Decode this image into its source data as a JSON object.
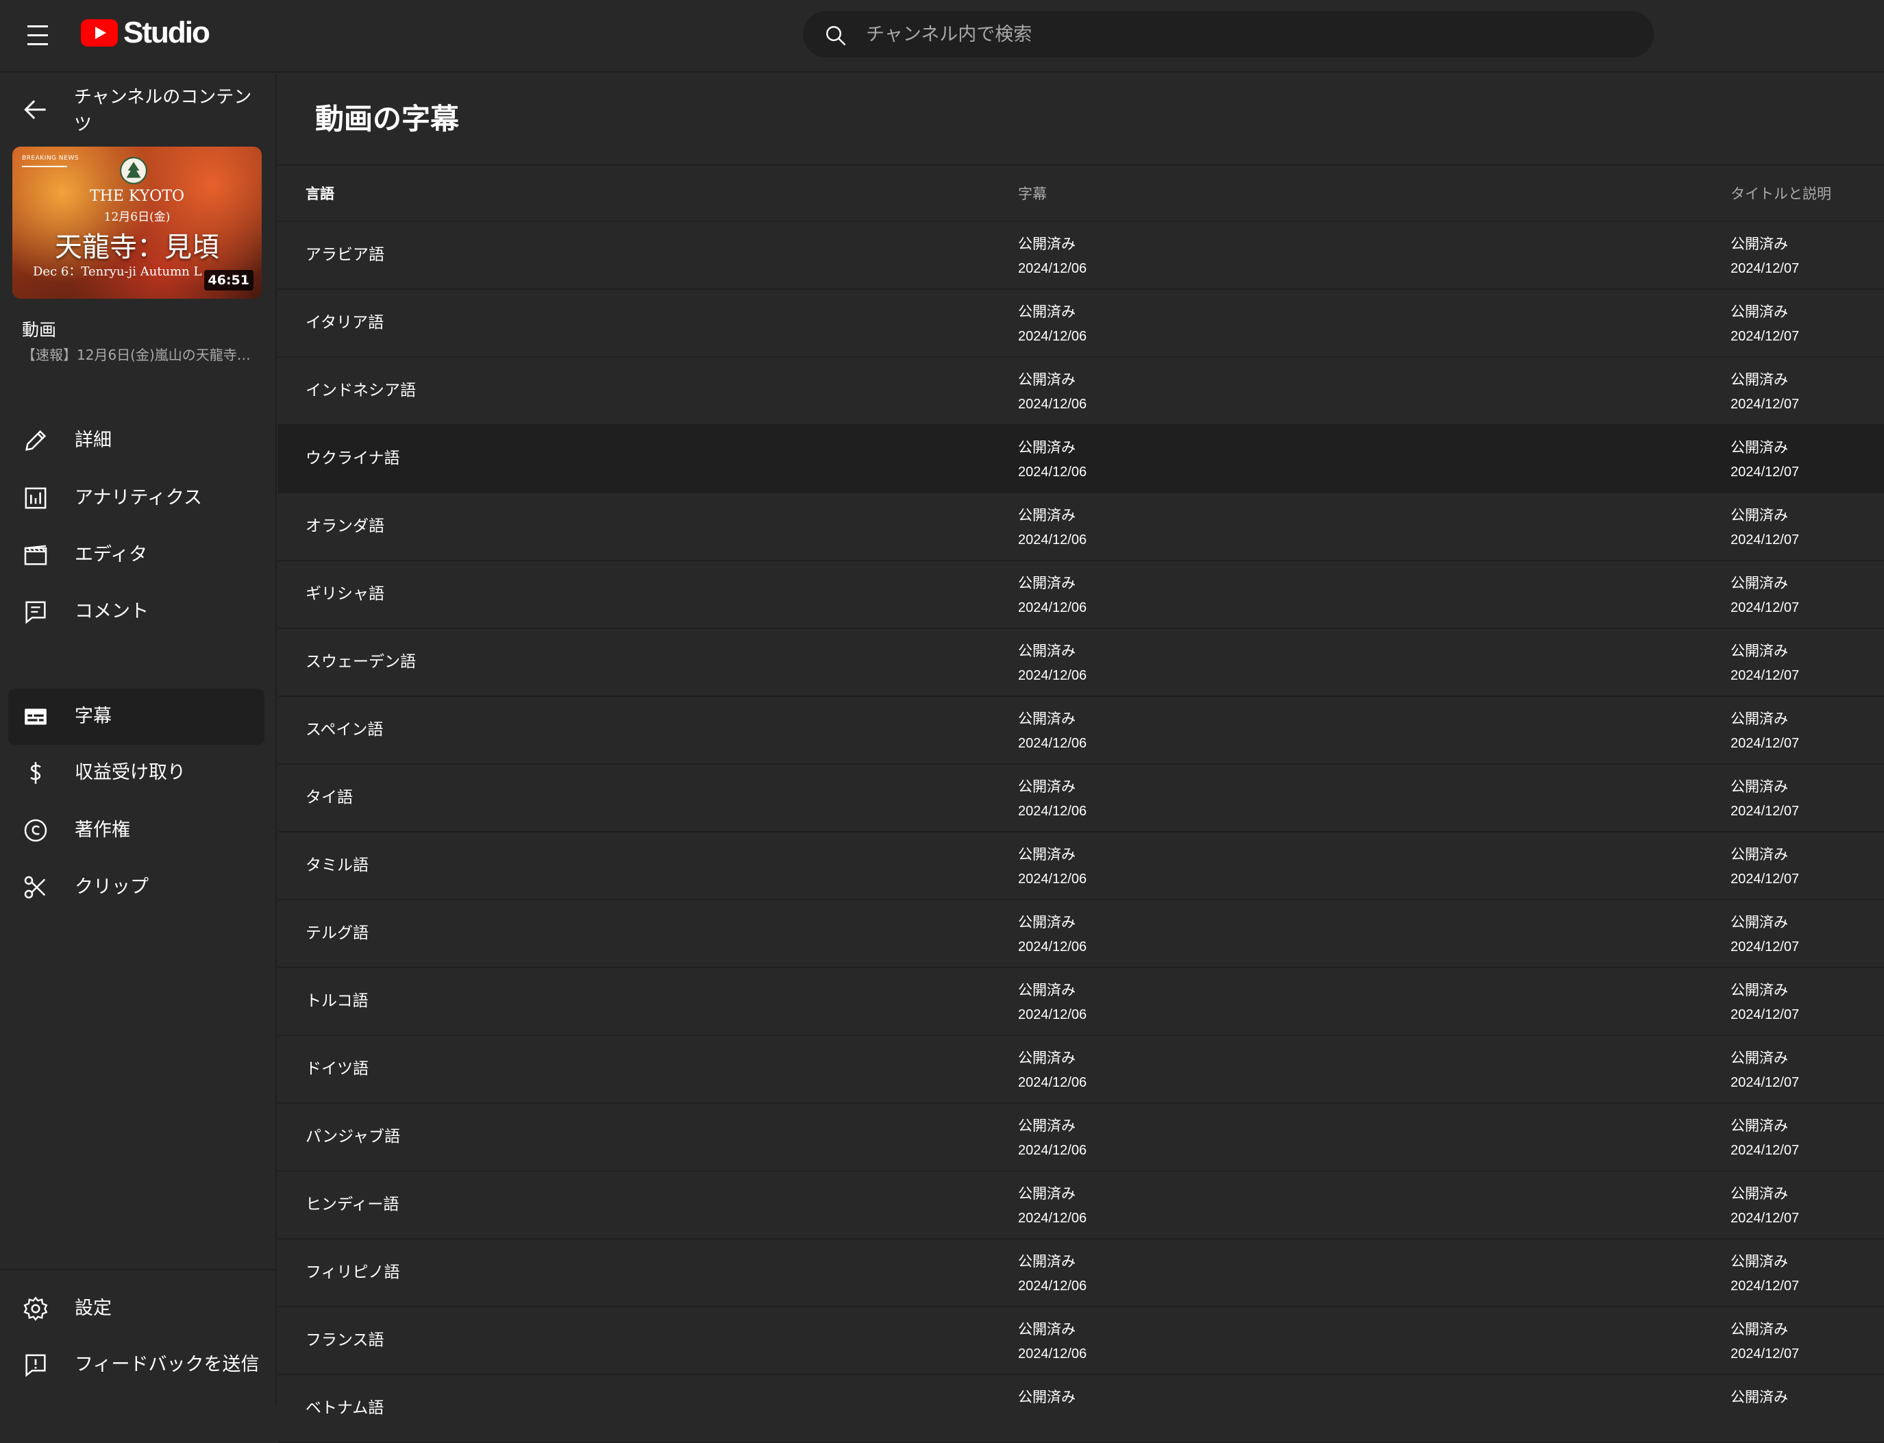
{
  "header": {
    "logo_text": "Studio",
    "search_placeholder": "チャンネル内で検索"
  },
  "sidebar": {
    "back_label": "チャンネルのコンテンツ",
    "thumbnail": {
      "badge": "BREAKING NEWS",
      "brand": "THE KYOTO",
      "date": "12月6日(金)",
      "title": "天龍寺：見頃",
      "subtitle": "Dec 6：Tenryu-ji Autumn L",
      "duration": "46:51"
    },
    "video_heading": "動画",
    "video_title": "【速報】12月6日(金)嵐山の天龍寺…",
    "nav": [
      {
        "label": "詳細",
        "icon": "pencil-icon"
      },
      {
        "label": "アナリティクス",
        "icon": "analytics-icon"
      },
      {
        "label": "エディタ",
        "icon": "editor-icon"
      },
      {
        "label": "コメント",
        "icon": "comment-icon"
      },
      {
        "label": "字幕",
        "icon": "subtitles-icon",
        "active": true
      },
      {
        "label": "収益受け取り",
        "icon": "dollar-icon"
      },
      {
        "label": "著作権",
        "icon": "copyright-icon"
      },
      {
        "label": "クリップ",
        "icon": "scissors-icon"
      }
    ],
    "bottom_nav": [
      {
        "label": "設定",
        "icon": "gear-icon"
      },
      {
        "label": "フィードバックを送信",
        "icon": "feedback-icon"
      }
    ]
  },
  "main": {
    "page_title": "動画の字幕",
    "columns": {
      "language": "言語",
      "subtitles": "字幕",
      "title_desc": "タイトルと説明"
    },
    "rows": [
      {
        "language": "アラビア語",
        "sub_status": "公開済み",
        "sub_date": "2024/12/06",
        "title_status": "公開済み",
        "title_date": "2024/12/07"
      },
      {
        "language": "イタリア語",
        "sub_status": "公開済み",
        "sub_date": "2024/12/06",
        "title_status": "公開済み",
        "title_date": "2024/12/07"
      },
      {
        "language": "インドネシア語",
        "sub_status": "公開済み",
        "sub_date": "2024/12/06",
        "title_status": "公開済み",
        "title_date": "2024/12/07"
      },
      {
        "language": "ウクライナ語",
        "sub_status": "公開済み",
        "sub_date": "2024/12/06",
        "title_status": "公開済み",
        "title_date": "2024/12/07"
      },
      {
        "language": "オランダ語",
        "sub_status": "公開済み",
        "sub_date": "2024/12/06",
        "title_status": "公開済み",
        "title_date": "2024/12/07"
      },
      {
        "language": "ギリシャ語",
        "sub_status": "公開済み",
        "sub_date": "2024/12/06",
        "title_status": "公開済み",
        "title_date": "2024/12/07"
      },
      {
        "language": "スウェーデン語",
        "sub_status": "公開済み",
        "sub_date": "2024/12/06",
        "title_status": "公開済み",
        "title_date": "2024/12/07"
      },
      {
        "language": "スペイン語",
        "sub_status": "公開済み",
        "sub_date": "2024/12/06",
        "title_status": "公開済み",
        "title_date": "2024/12/07"
      },
      {
        "language": "タイ語",
        "sub_status": "公開済み",
        "sub_date": "2024/12/06",
        "title_status": "公開済み",
        "title_date": "2024/12/07"
      },
      {
        "language": "タミル語",
        "sub_status": "公開済み",
        "sub_date": "2024/12/06",
        "title_status": "公開済み",
        "title_date": "2024/12/07"
      },
      {
        "language": "テルグ語",
        "sub_status": "公開済み",
        "sub_date": "2024/12/06",
        "title_status": "公開済み",
        "title_date": "2024/12/07"
      },
      {
        "language": "トルコ語",
        "sub_status": "公開済み",
        "sub_date": "2024/12/06",
        "title_status": "公開済み",
        "title_date": "2024/12/07"
      },
      {
        "language": "ドイツ語",
        "sub_status": "公開済み",
        "sub_date": "2024/12/06",
        "title_status": "公開済み",
        "title_date": "2024/12/07"
      },
      {
        "language": "パンジャブ語",
        "sub_status": "公開済み",
        "sub_date": "2024/12/06",
        "title_status": "公開済み",
        "title_date": "2024/12/07"
      },
      {
        "language": "ヒンディー語",
        "sub_status": "公開済み",
        "sub_date": "2024/12/06",
        "title_status": "公開済み",
        "title_date": "2024/12/07"
      },
      {
        "language": "フィリピノ語",
        "sub_status": "公開済み",
        "sub_date": "2024/12/06",
        "title_status": "公開済み",
        "title_date": "2024/12/07"
      },
      {
        "language": "フランス語",
        "sub_status": "公開済み",
        "sub_date": "2024/12/06",
        "title_status": "公開済み",
        "title_date": "2024/12/07"
      },
      {
        "language": "ベトナム語",
        "sub_status": "公開済み",
        "sub_date": "",
        "title_status": "公開済み",
        "title_date": ""
      }
    ]
  },
  "colors": {
    "background": "#282828",
    "divider": "#1f1f1f",
    "active_nav": "#1f1f1f",
    "logo_red": "#ff0000",
    "secondary_text": "#aaaaaa"
  }
}
